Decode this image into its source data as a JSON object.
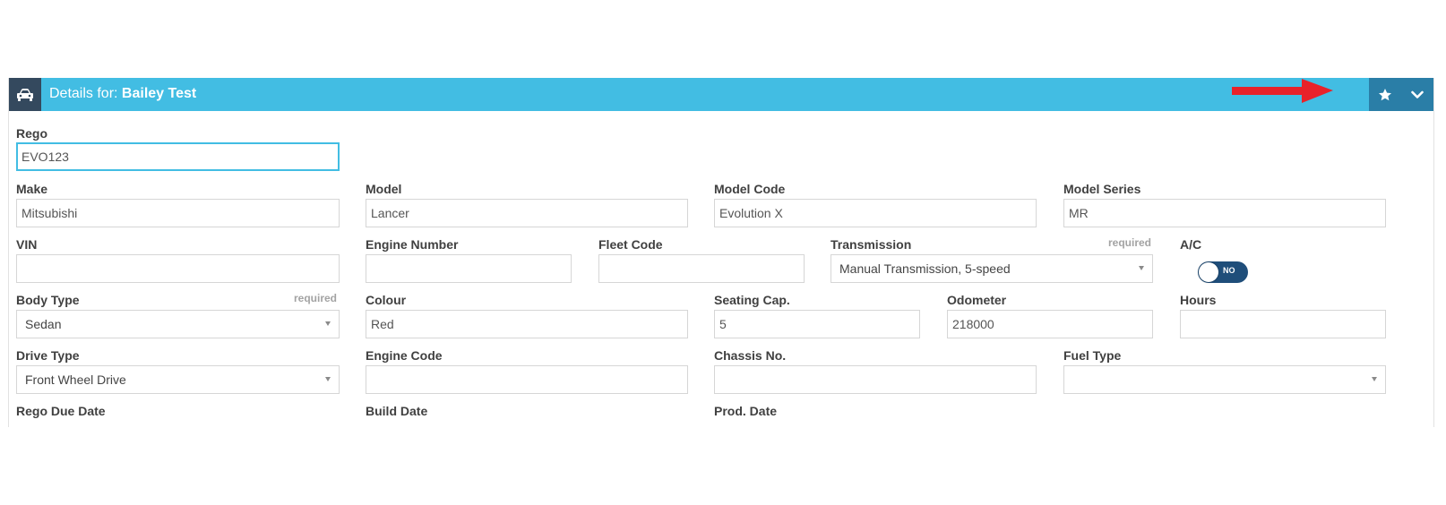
{
  "header": {
    "prefix": "Details for:",
    "name": "Bailey Test"
  },
  "fields": {
    "rego": {
      "label": "Rego",
      "value": "EVO123"
    },
    "make": {
      "label": "Make",
      "value": "Mitsubishi"
    },
    "model": {
      "label": "Model",
      "value": "Lancer"
    },
    "model_code": {
      "label": "Model Code",
      "value": "Evolution X"
    },
    "model_series": {
      "label": "Model Series",
      "value": "MR"
    },
    "vin": {
      "label": "VIN",
      "value": ""
    },
    "engine_number": {
      "label": "Engine Number",
      "value": ""
    },
    "fleet_code": {
      "label": "Fleet Code",
      "value": ""
    },
    "transmission": {
      "label": "Transmission",
      "required": "required",
      "value": "Manual Transmission, 5-speed"
    },
    "ac": {
      "label": "A/C",
      "toggle": "NO"
    },
    "body_type": {
      "label": "Body Type",
      "required": "required",
      "value": "Sedan"
    },
    "colour": {
      "label": "Colour",
      "value": "Red"
    },
    "seating_cap": {
      "label": "Seating Cap.",
      "value": "5"
    },
    "odometer": {
      "label": "Odometer",
      "value": "218000"
    },
    "hours": {
      "label": "Hours",
      "value": ""
    },
    "drive_type": {
      "label": "Drive Type",
      "value": "Front Wheel Drive"
    },
    "engine_code": {
      "label": "Engine Code",
      "value": ""
    },
    "chassis_no": {
      "label": "Chassis No.",
      "value": ""
    },
    "fuel_type": {
      "label": "Fuel Type",
      "value": ""
    },
    "rego_due_date": {
      "label": "Rego Due Date"
    },
    "build_date": {
      "label": "Build Date"
    },
    "prod_date": {
      "label": "Prod. Date"
    }
  },
  "icons": {
    "header": "car-icon",
    "favourite": "star-icon",
    "collapse": "chevron-down-icon",
    "annotation": "red-arrow-icon"
  },
  "colors": {
    "header": "#42bde3",
    "header_buttons": "#2a7ea7",
    "icon_box": "#34495e",
    "arrow": "#e8222a",
    "toggle": "#1f4e7a"
  }
}
